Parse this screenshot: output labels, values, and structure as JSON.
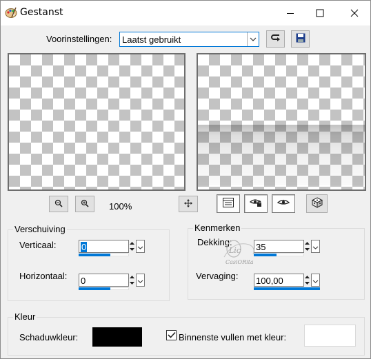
{
  "window": {
    "title": "Gestanst",
    "icons": {
      "app": "paint-palette-icon",
      "minimize": "minimize-icon",
      "maximize": "maximize-icon",
      "close": "close-icon"
    }
  },
  "presets": {
    "label": "Voorinstellingen:",
    "selected": "Laatst gebruikt",
    "reset_icon": "reset-icon",
    "save_icon": "save-icon"
  },
  "preview": {
    "zoom_out_icon": "zoom-out-icon",
    "zoom_in_icon": "zoom-in-icon",
    "zoom_level": "100%",
    "pan_icon": "move-icon",
    "toggle_icons": [
      "properties-icon",
      "eye-lock-icon",
      "eye-icon"
    ],
    "random_icon": "dice-icon"
  },
  "offset": {
    "group_label": "Verschuiving",
    "vertical_label": "Verticaal:",
    "vertical_value": "0",
    "horizontal_label": "Horizontaal:",
    "horizontal_value": "0"
  },
  "attributes": {
    "group_label": "Kenmerken",
    "opacity_label": "Dekking:",
    "opacity_value": "35",
    "blur_label": "Vervaging:",
    "blur_value": "100,00"
  },
  "color": {
    "group_label": "Kleur",
    "shadow_label": "Schaduwkleur:",
    "shadow_color": "#000000",
    "fill_label": "Binnenste vullen met kleur:",
    "fill_checked": true,
    "fill_color": "#ffffff"
  },
  "watermark": {
    "line1": "Lic",
    "line2": "CasiORita"
  },
  "colors": {
    "accent": "#0078d7",
    "window_bg": "#f0f0f0"
  }
}
